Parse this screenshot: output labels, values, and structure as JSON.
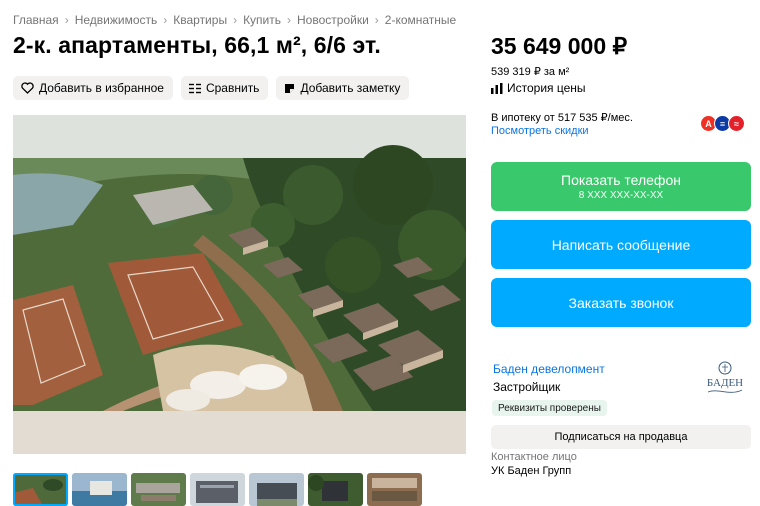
{
  "breadcrumb": [
    "Главная",
    "Недвижимость",
    "Квартиры",
    "Купить",
    "Новостройки",
    "2-комнатные"
  ],
  "title": "2-к. апартаменты, 66,1 м², 6/6 эт.",
  "actions": {
    "favorite": "Добавить в избранное",
    "compare": "Сравнить",
    "note": "Добавить заметку"
  },
  "price": {
    "total": "35 649 000 ₽",
    "per_m2": "539 319 ₽ за м²",
    "history": "История цены"
  },
  "mortgage": {
    "text": "В ипотеку от 517 535 ₽/мес.",
    "discounts": "Посмотреть скидки",
    "banks": [
      {
        "letter": "А",
        "color": "#ef3124"
      },
      {
        "letter": "≡",
        "color": "#0b3aa6"
      },
      {
        "letter": "≈",
        "color": "#e4202a"
      }
    ]
  },
  "buttons": {
    "phone": "Показать телефон",
    "phone_mask": "8 XXX XXX-XX-XX",
    "message": "Написать сообщение",
    "call": "Заказать звонок",
    "subscribe": "Подписаться на продавца"
  },
  "developer": {
    "name": "Баден девелопмент",
    "role": "Застройщик",
    "badge": "Реквизиты проверены",
    "logo_text": "БАДЕН"
  },
  "contact": {
    "label": "Контактное лицо",
    "name": "УК Баден Групп"
  },
  "colors": {
    "green": "#39c86b",
    "blue": "#00aaff",
    "link": "#0a75e0"
  },
  "thumbnails": [
    {
      "name": "thumb-1",
      "active": true
    },
    {
      "name": "thumb-2",
      "active": false
    },
    {
      "name": "thumb-3",
      "active": false
    },
    {
      "name": "thumb-4",
      "active": false
    },
    {
      "name": "thumb-5",
      "active": false
    },
    {
      "name": "thumb-6",
      "active": false
    },
    {
      "name": "thumb-7",
      "active": false
    }
  ]
}
